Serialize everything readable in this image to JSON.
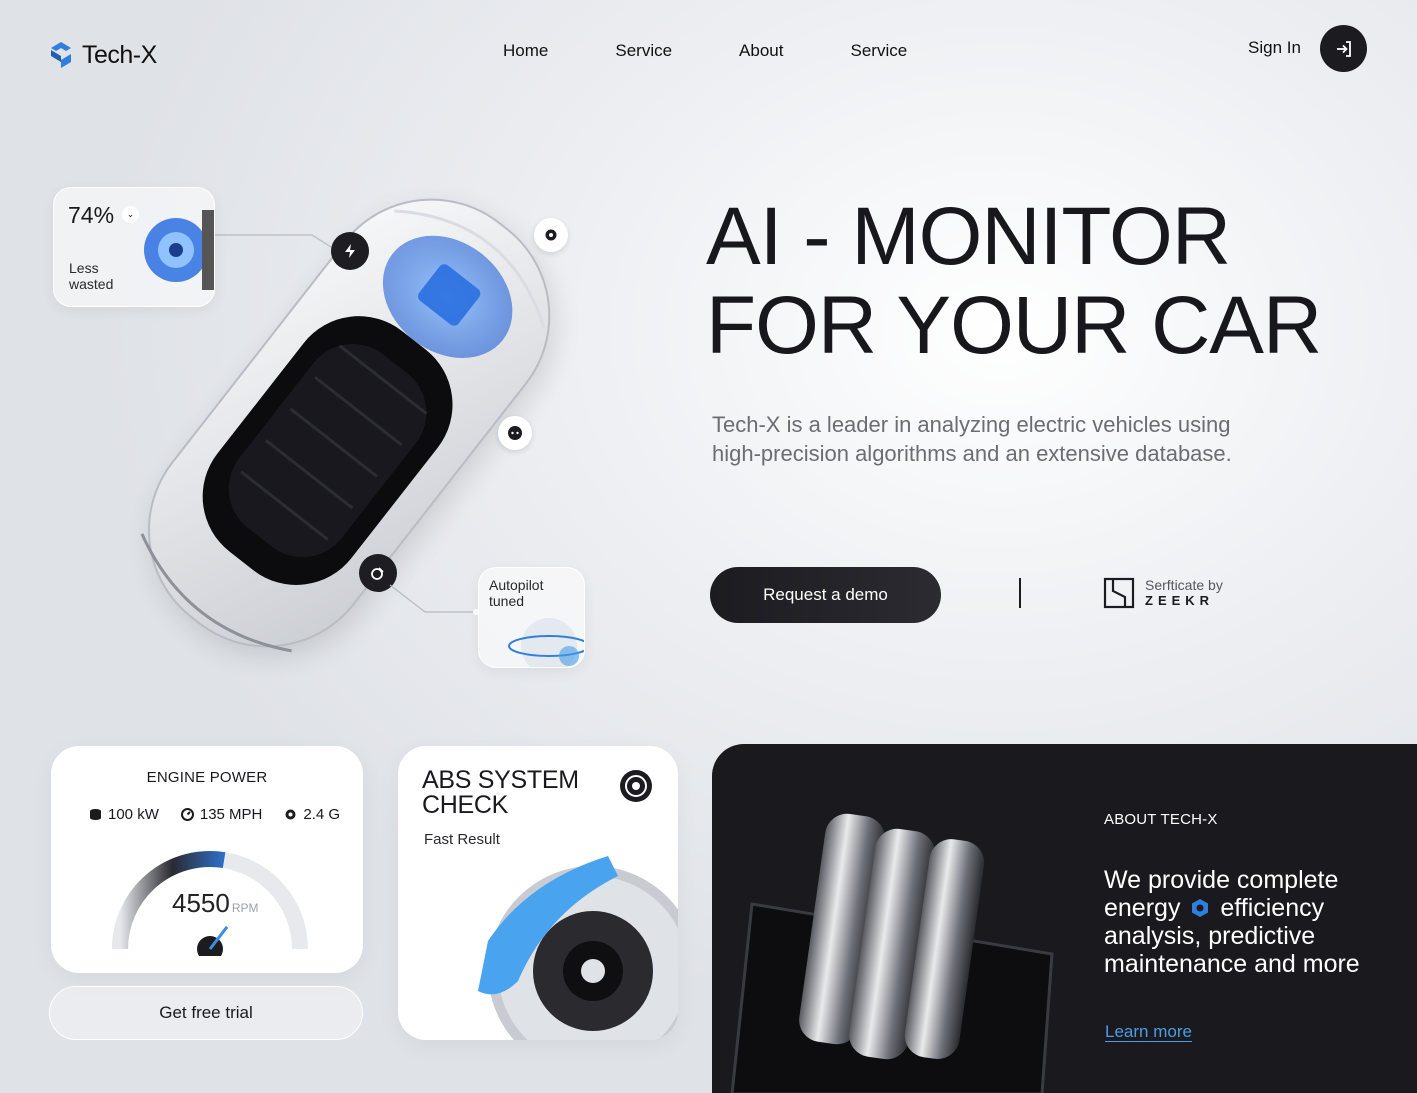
{
  "brand": {
    "name": "Tech-X"
  },
  "nav": {
    "items": [
      {
        "label": "Home"
      },
      {
        "label": "Service"
      },
      {
        "label": "About"
      },
      {
        "label": "Service"
      }
    ]
  },
  "auth": {
    "signin_label": "Sign In"
  },
  "hero": {
    "title_line1": "AI - MONITOR",
    "title_line2": "FOR YOUR CAR",
    "description": "Tech-X is a leader in analyzing electric vehicles using high-precision algorithms and an extensive database.",
    "demo_label": "Request a demo",
    "cert_label": "Serfticate by",
    "cert_brand": "ZEEKR"
  },
  "callouts": {
    "waste_value": "74%",
    "waste_label_1": "Less",
    "waste_label_2": "wasted",
    "autopilot_1": "Autopilot",
    "autopilot_2": "tuned"
  },
  "engine": {
    "title": "ENGINE POWER",
    "stat_power": "100 kW",
    "stat_speed": "135 MPH",
    "stat_g": "2.4 G",
    "rpm_value": "4550",
    "rpm_unit": "RPM",
    "gauge_fraction": 0.55,
    "trial_label": "Get free trial"
  },
  "abs": {
    "title_line1": "ABS SYSTEM",
    "title_line2": "CHECK",
    "subtitle": "Fast Result"
  },
  "about": {
    "label": "ABOUT TECH-X",
    "text_1": "We provide complete",
    "text_2a": "energy",
    "text_2b": "efficiency",
    "text_3": "analysis, predictive",
    "text_4": "maintenance and more",
    "learn_label": "Learn more"
  },
  "colors": {
    "accent": "#2f7fdc",
    "dark": "#1b1b20",
    "link": "#4a9de6"
  }
}
